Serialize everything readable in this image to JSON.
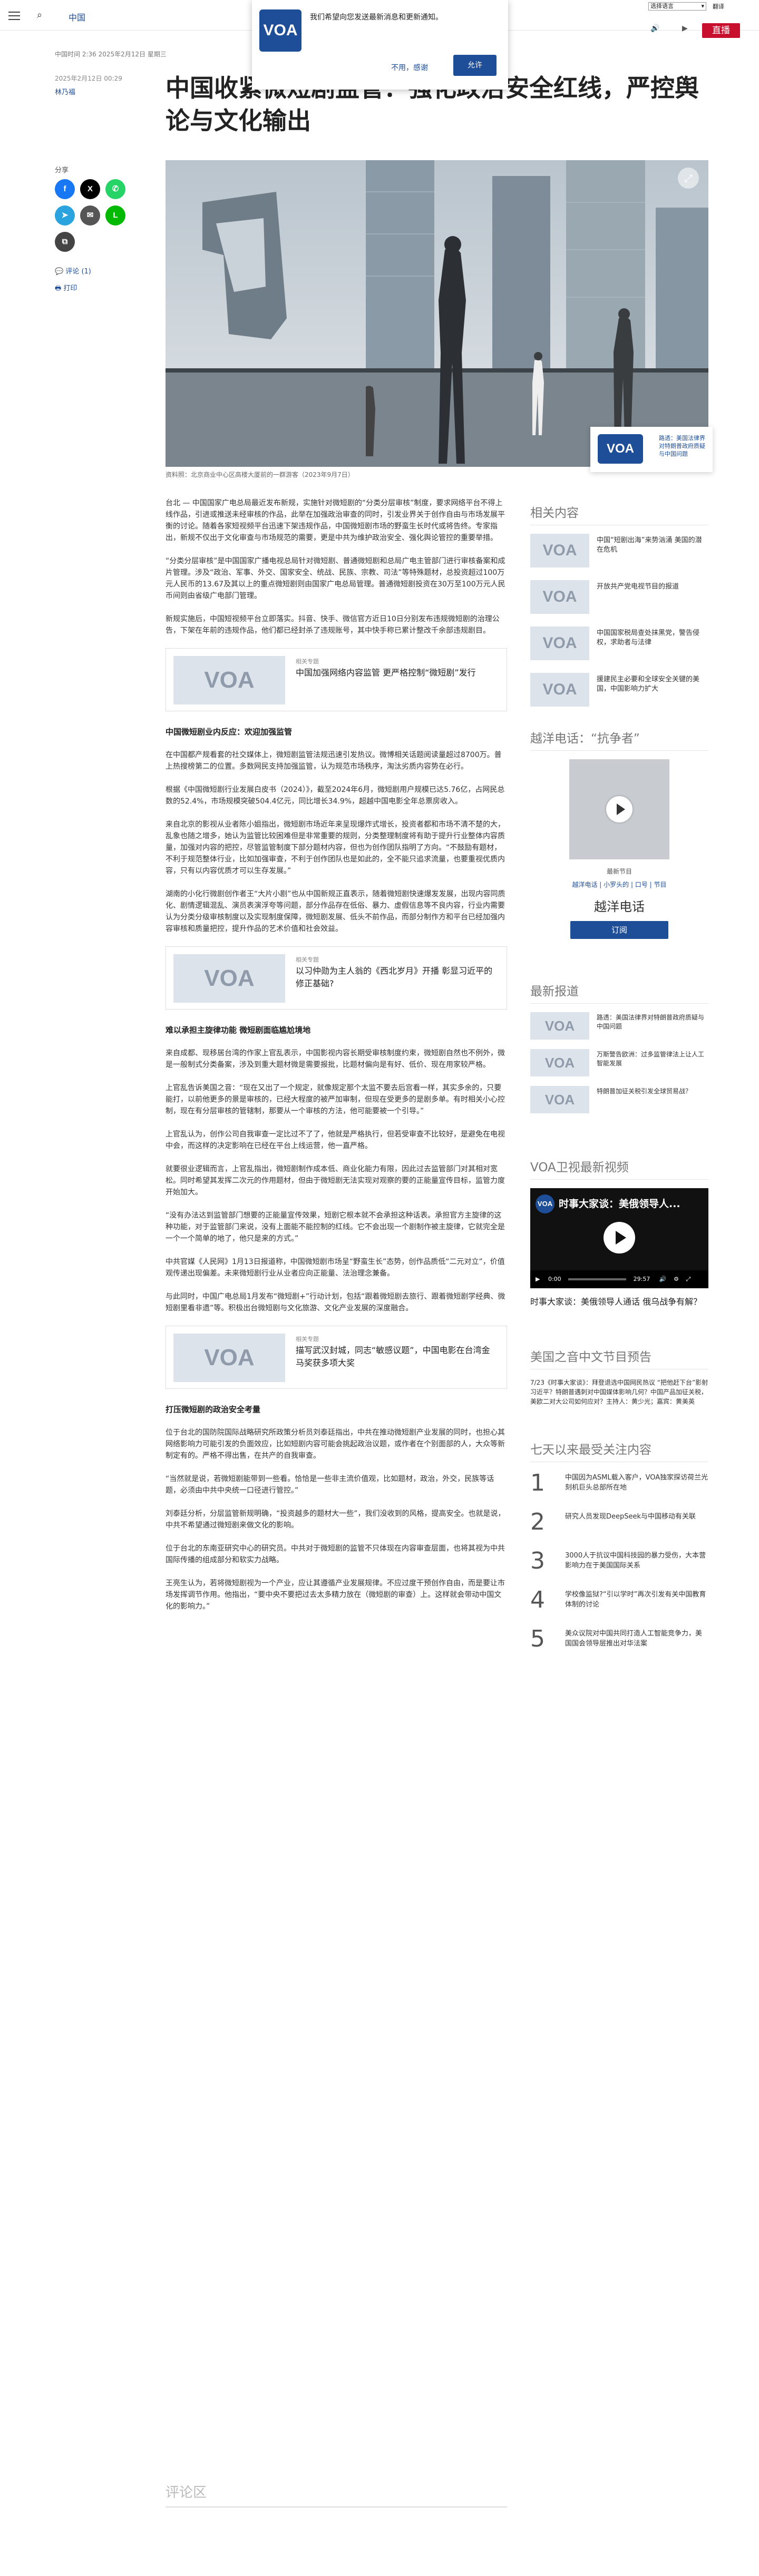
{
  "header": {
    "section_title": "中国",
    "lang_select": "选择语言",
    "lang_arrow": "▾",
    "translate_label": "翻译",
    "live_label": "直播",
    "search_icon": "search-icon",
    "menu_icon": "menu-icon"
  },
  "notification": {
    "logo": "VOA",
    "message": "我们希望向您发送最新消息和更新通知。",
    "decline": "不用，感谢",
    "accept": "允许"
  },
  "article_meta": {
    "dateline": "中国时间 2:36 2025年2月12日 星期三",
    "updated": "2025年2月12日 00:29",
    "author": "林乃福"
  },
  "headline": "中国收紧微短剧监管：强化政治安全红线，严控舆论与文化输出",
  "share": {
    "label": "分享",
    "comments": "评论 (1)",
    "print": "打印"
  },
  "hero": {
    "caption": "资料照：北京商业中心区高楼大厦前的一群游客（2023年9月7日）"
  },
  "related_popup": {
    "logo": "VOA",
    "text": "路透：美国法律界对特朗普政府质疑与中国问题"
  },
  "article": {
    "p1": "台北 — 中国国家广电总局最近发布新规，实施针对微短剧的“分类分层审核”制度，要求网络平台不得上线作品，引进或推送未经审核的作品，此举在加强政治审查的同时，引发业界关于创作自由与市场发展平衡的讨论。随着各家短视频平台迅速下架违规作品，中国微短剧市场的野蛮生长时代或将告终。专家指出，新规不仅出于文化审查与市场规范的需要，更是中共为维护政治安全、强化舆论管控的重要举措。",
    "p2": "“分类分层审核”是中国国家广播电视总局针对微短剧、普通微短剧和总局广电主管部门进行审核备案和成片管理。涉及“政治、军事、外交、国家安全、统战、民族、宗教、司法”等特殊题材，总投资超过100万元人民币的13.67及其以上的重点微短剧则由国家广电总局管理。普通微短剧投资在30万至100万元人民币间则由省级广电部门管理。",
    "p3": "新规实施后，中国短视频平台立即落实。抖音、快手、微信官方近日10日分别发布违规微短剧的治理公告，下架在年前的违规作品，他们都已经封杀了违规账号，其中快手称已累计整改千余部违规剧目。",
    "related1_kicker": "相关专题",
    "related1_title": "中国加强网络内容监管 更严格控制“微短剧”发行",
    "h_1": "中国微短剧业内反应：欢迎加强监管",
    "p4": "在中国都产规看套的社交媒体上，微短剧监管法规迅速引发热议。微博相关话题阅读量超过8700万。普上热搜榜第二的位置。多数网民支持加强监管，认为规范市场秩序，淘汰劣质内容势在必行。",
    "p5": "根据《中国微短剧行业发展白皮书（2024）》，截至2024年6月，微短剧用户规模已达5.76亿，占网民总数的52.4%，市场规模突破504.4亿元，同比增长34.9%，超越中国电影全年总票房收入。",
    "p6": "来自北京的影视从业者陈小姐指出，微短剧市场近年来呈现爆炸式增长，投资者都和市场不清不楚的大，乱象也随之增多，她认为监管比较困难但是非常重要的规则，分类整理制度将有助于提升行业整体内容质量，加强对内容的把控，尽管监管制度下部分题材内容，但也为创作团队指明了方向。“不鼓励有题材，不利于规范整体行业，比如加强审查，不利于创作团队也是如此的，全不能只追求流量，也要重视优质内容，只有以内容优质才可以生存发展。”",
    "p7": "湖南的小化行微剧创作者王“大片小剧”也从中国新规正直表示，随着微短剧快速爆发发展，出现内容同质化、剧情逻辑混乱、演员表演浮夸等问题，部分作品存在低俗、暴力、虚假信息等不良内容，行业内需要认为分类分级审核制度以及实现制度保障，微短剧发展、低头不前作品，而部分制作方和平台已经加强内容审核和质量把控，提升作品的艺术价值和社会效益。",
    "related2_kicker": "相关专题",
    "related2_title": "以习仲勋为主人翁的《西北岁月》开播 彰显习近平的修正基础?",
    "h_2": "难以承担主旋律功能 微短剧面临尴尬境地",
    "p8": "来自成都、现移居台湾的作家上官乱表示，中国影视内容长期受审核制度约束，微短剧自然也不例外，微是一般制式分类备案，涉及到重大题材微是需要报批，比题材偏向是有好、低价、现在用家较严格。",
    "p9": "上官乱告诉美国之音：“现在又出了一个规定，就像规定那个太监不要去后宫看一样，其实多余的，只要能打，以前他更多的景是审核的，已经大程度的被严加审制，但现在受更多的是剧多单。有时相关小心控制，现在有分层审核的管辖制，那要从一个审核的方法，他可能要被一个引导。”",
    "p10": "上官乱认为，创作公司自我审查一定比过不了了，他就是严格执行，但若受审查不比较好，是避免在电视中会，而这样的决定影响在已经在平台上线运营，他一直严格。",
    "p11": "就要很业逻辑而言，上官乱指出，微短剧制作成本低、商业化能力有限，因此过去监管部门对其相对宽松。同时希望其发挥二次元的作用题材，但由于微短剧无法实现对观察的要的正能量宣传目标，监管力度开始加大。",
    "p12": "“没有办法达到监管部门想要的正能量宣传效果，短剧它根本就不会承担这种话表。承担官方主旋律的这种功能，对于监管部门来说，没有上面能不能控制的红线。它不会出现一个剧制作被主旋律，它就完全是一个一个简单的地了，他只是来的方式。”",
    "p13": "中共官媒《人民网》1月13日报道称，中国微短剧市场呈“野蛮生长”态势，创作品质低“二元对立”，价值观传递出现偏差。未来微短剧行业从业者应向正能量、法治理念兼备。",
    "p14": "与此同时，中国广电总局1月发布“微短剧+”行动计划，包括“跟着微短剧去旅行、跟着微短剧学经典、微短剧里看非遗”等。积极出台微短剧与文化旅游、文化产业发展的深度融合。",
    "related3_kicker": "相关专题",
    "related3_title": "描写武汉封城，同志“敏感议题”，中国电影在台湾金马奖获多项大奖",
    "h_3": "打压微短剧的政治安全考量",
    "p15": "位于台北的国防院国际战略研究所政策分析员刘泰廷指出，中共在推动微短剧产业发展的同时，也担心其网络影响力可能引发的负面效应，比如短剧内容可能会挑起政治议题，或作者在个别面部的人，大众等新制定有的。严格不得出售，在共产的自我审查。",
    "p16": "“当然就是说，若微短剧能带到一些看。恰恰是一些非主流价值观，比如题材，政治，外交，民族等话题，必须由中共中央统一口径进行管控。”",
    "p17": "刘泰廷分析，分层监管新规明确，“投资越多的题材大一些”，我们没收到的风格，提高安全。也就是说，中共不希望通过微短剧来做文化的影响。",
    "p18": "位于台北的东南亚研究中心的研究员。中共对于微短剧的监管不只体现在内容审查层面，也将其视为中共国际传播的组成部分和软实力战略。",
    "p19": "王亮生认为，若将微短剧视为一个产业，应让其遵循产业发展规律。不应过度干预创作自由，而是要让市场发挥调节作用。他指出，“要中央不要把过去太多精力放在（微短剧的审查）上。这样就会带动中国文化的影响力。”"
  },
  "comments_head": "评论区",
  "rail": {
    "related_title": "相关内容",
    "related": [
      "中国“短剧出海”来势汹涌 美国的潜在危机",
      "开放共产党电视节目的报道",
      "中国国家税局查处抹黑党，警告侵权，求助者与法律",
      "援建民主必要和全球安全关键的美国，中国影响力扩大"
    ],
    "program_title": "越洋电话：“抗争者”",
    "program_kicker": "最新节目",
    "program_links": "越洋电话 | 小罗头的 | 口号 | 节目",
    "program_name": "越洋电话",
    "subscribe": "订阅",
    "latest_title": "最新报道",
    "latest": [
      "路透：美国法律界对特朗普政府质疑与中国问题",
      "万斯警告欧洲：过多监管律法上让人工智能发展",
      "特朗普加征关税引发全球贸易战？"
    ],
    "video_title": "VOA卫视最新视频",
    "video_overlay": "时事大家谈：美俄领导人...",
    "video_time_left": "0:00",
    "video_time_right": "29:57",
    "video_caption": "时事大家谈：美俄领导人通话 俄乌战争有解？",
    "tv_title": "美国之音中文节目预告",
    "tv_text": "7/23《时事大家谈》：拜登退选中国网民热议 “把他赶下台”影射习近平？特朗普遇刺对中国媒体影响几何？中国产品加征关税，美欧二对大公司如何应对？主持人：黄少光；嘉宾：黄美英",
    "most_title": "七天以来最受关注内容",
    "most": [
      "中国因为ASML载入客户，VOA独家探访荷兰光刻机巨头总部所在地",
      "研究人员发现DeepSeek与中国移动有关联",
      "3000人于抗议中国科技园的暴力受伤，大本营影响力在于美国国际关系",
      "学校像监狱?“引以学时”再次引发有关中国教育体制的讨论",
      "美众议院对中国共同打造人工智能竞争力，美国国会领导层推出对华法案"
    ]
  }
}
